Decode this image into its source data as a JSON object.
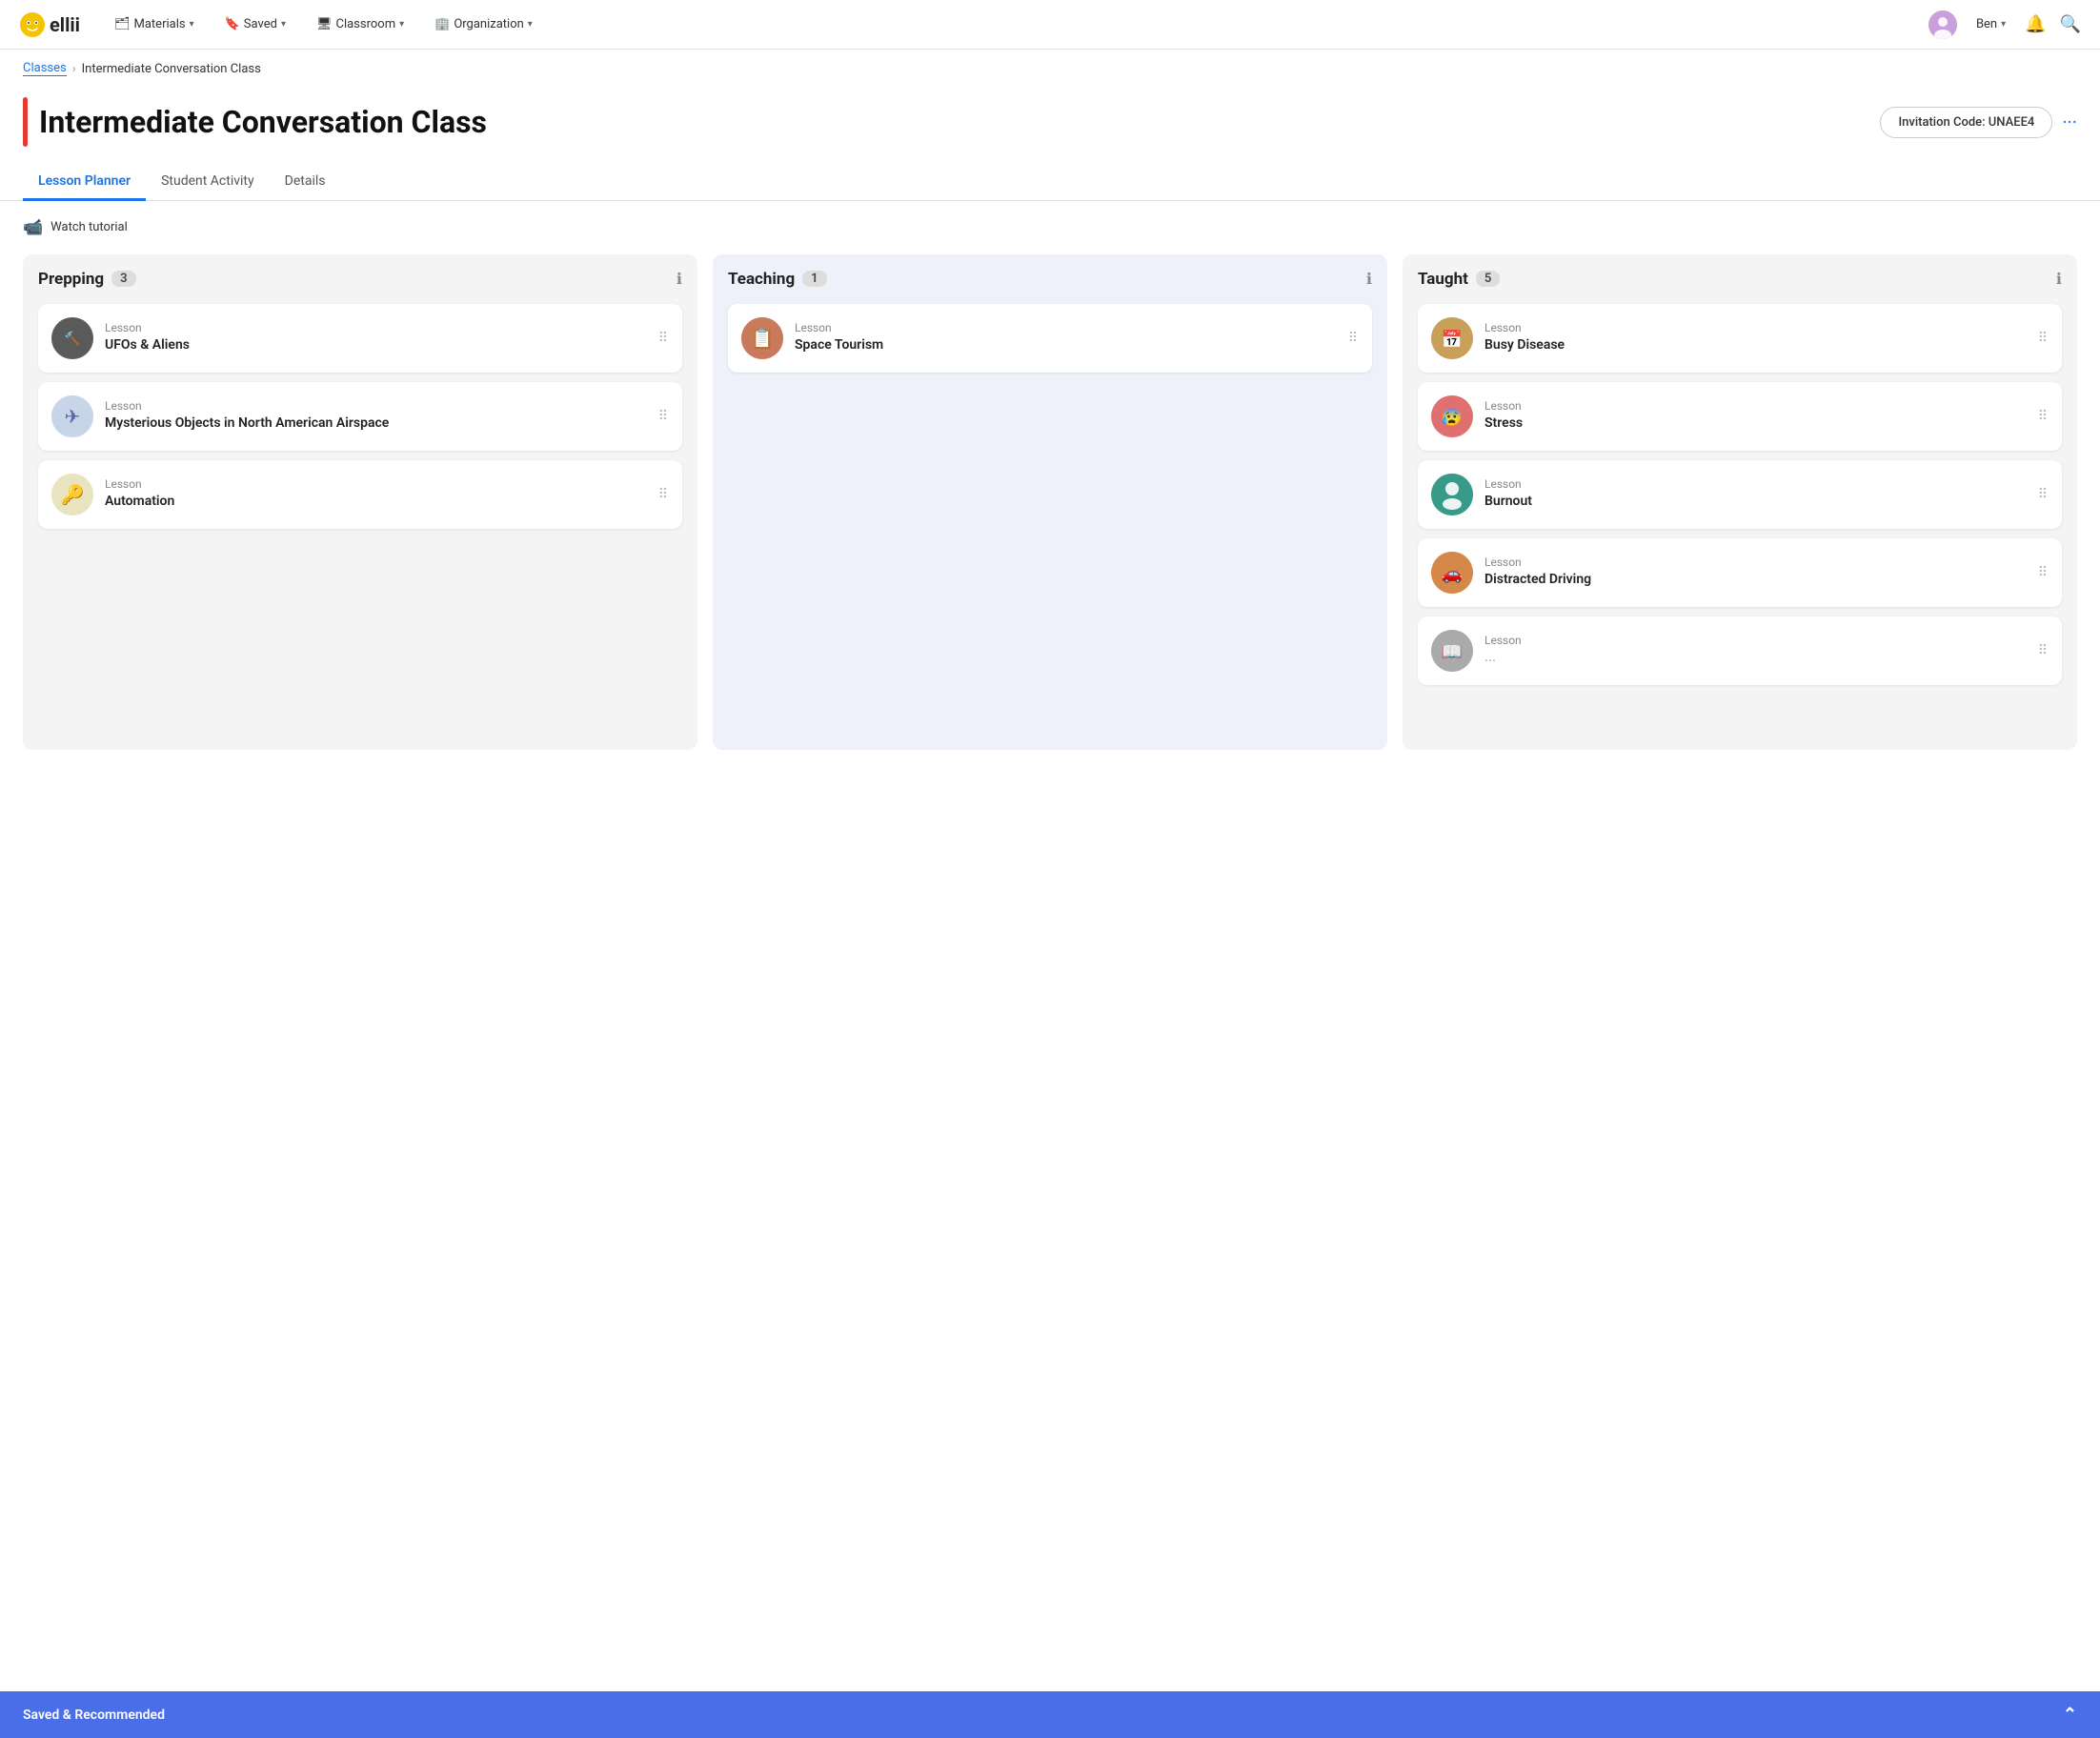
{
  "app": {
    "logo_text": "ellii"
  },
  "nav": {
    "items": [
      {
        "label": "Materials",
        "icon": "📁"
      },
      {
        "label": "Saved",
        "icon": "🔖"
      },
      {
        "label": "Classroom",
        "icon": "🖥"
      },
      {
        "label": "Organization",
        "icon": "🏢"
      }
    ],
    "user_name": "Ben",
    "search_icon": "🔍",
    "bell_icon": "🔔"
  },
  "breadcrumb": {
    "parent": "Classes",
    "current": "Intermediate Conversation Class"
  },
  "header": {
    "title": "Intermediate Conversation Class",
    "invitation_label": "Invitation Code: UNAEE4",
    "more_icon": "···"
  },
  "tabs": [
    {
      "label": "Lesson Planner",
      "active": true
    },
    {
      "label": "Student Activity",
      "active": false
    },
    {
      "label": "Details",
      "active": false
    }
  ],
  "watch_tutorial": {
    "label": "Watch tutorial"
  },
  "columns": [
    {
      "id": "prepping",
      "title": "Prepping",
      "count": "3",
      "cards": [
        {
          "label": "Lesson",
          "title": "UFOs & Aliens",
          "icon_bg": "#5a5a5a",
          "icon": "🔨"
        },
        {
          "label": "Lesson",
          "title": "Mysterious Objects in North American Airspace",
          "icon_bg": "#d0d8e8",
          "icon": "✈️"
        },
        {
          "label": "Lesson",
          "title": "Automation",
          "icon_bg": "#e0ddc0",
          "icon": "🔑"
        }
      ]
    },
    {
      "id": "teaching",
      "title": "Teaching",
      "count": "1",
      "cards": [
        {
          "label": "Lesson",
          "title": "Space Tourism",
          "icon_bg": "#c97a5a",
          "icon": "📋"
        }
      ]
    },
    {
      "id": "taught",
      "title": "Taught",
      "count": "5",
      "cards": [
        {
          "label": "Lesson",
          "title": "Busy Disease",
          "icon_bg": "#c9a05a",
          "icon": "📅"
        },
        {
          "label": "Lesson",
          "title": "Stress",
          "icon_bg": "#e07070",
          "icon": "😰"
        },
        {
          "label": "Lesson",
          "title": "Burnout",
          "icon_bg": "#3a9a8a",
          "icon": "👤"
        },
        {
          "label": "Lesson",
          "title": "Distracted Driving",
          "icon_bg": "#d4884a",
          "icon": "🚗"
        },
        {
          "label": "Lesson",
          "title": "...",
          "icon_bg": "#aaaaaa",
          "icon": "📖"
        }
      ]
    }
  ],
  "bottom_bar": {
    "label": "Saved & Recommended"
  }
}
